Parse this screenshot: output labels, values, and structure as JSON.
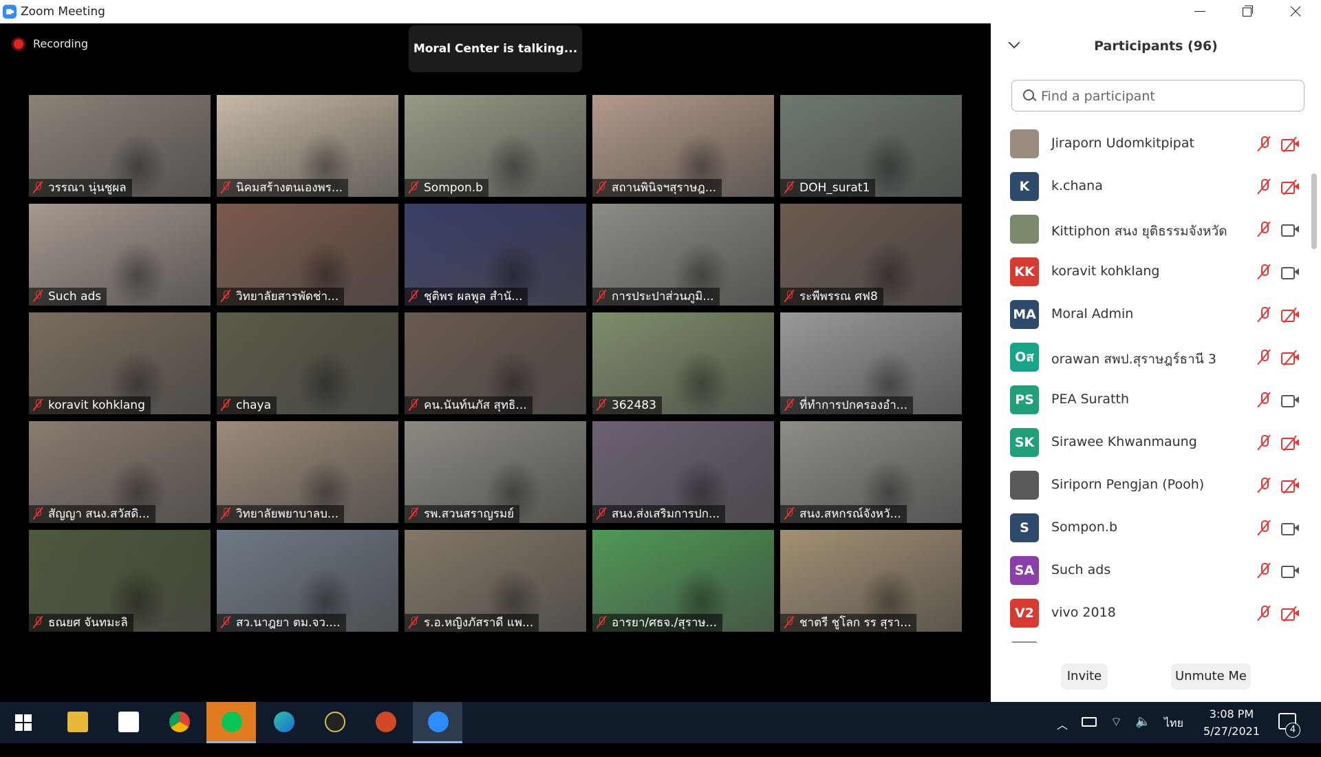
{
  "window": {
    "title": "Zoom Meeting"
  },
  "meeting": {
    "recording_label": "Recording",
    "talking_banner": "Moral Center is talking..."
  },
  "video_tiles": [
    {
      "name": "วรรณา นุ่นชูผล",
      "bg": "#8c8278"
    },
    {
      "name": "นิคมสร้างตนเองพร...",
      "bg": "#c7b9a6"
    },
    {
      "name": "Sompon.b",
      "bg": "#9a9a88"
    },
    {
      "name": "สถานพินิจฯสุราษฎ...",
      "bg": "#b59b8a"
    },
    {
      "name": "DOH_surat1",
      "bg": "#6e7a6e"
    },
    {
      "name": "Such ads",
      "bg": "#a79a90"
    },
    {
      "name": "วิทยาลัยสารพัดช่า...",
      "bg": "#7c5a4c"
    },
    {
      "name": "ชุติพร ผลพูล สำนั...",
      "bg": "#3a3f6a"
    },
    {
      "name": "การประปาส่วนภูมิ...",
      "bg": "#8d8d86"
    },
    {
      "name": "ระพีพรรณ ศฟ8",
      "bg": "#6b5a4f"
    },
    {
      "name": "koravit kohklang",
      "bg": "#7a6d5e"
    },
    {
      "name": "chaya",
      "bg": "#5d5a48"
    },
    {
      "name": "คน.นันท์นภัส สุทธิ...",
      "bg": "#6a5a50"
    },
    {
      "name": "362483",
      "bg": "#7f8e6a"
    },
    {
      "name": "ที่ทำการปกครองอำ...",
      "bg": "#9a9a9a"
    },
    {
      "name": "สัญญา สนง.สวัสดิ...",
      "bg": "#8a7c70"
    },
    {
      "name": "วิทยาลัยพยาบาลบ...",
      "bg": "#9c8b7a"
    },
    {
      "name": "รพ.สวนสราญรมย์",
      "bg": "#8d8a82"
    },
    {
      "name": "สนง.ส่งเสริมการปก...",
      "bg": "#6d6274"
    },
    {
      "name": "สนง.สหกรณ์จังหวั...",
      "bg": "#8e8d87"
    },
    {
      "name": "ธณยศ จันทมะลิ",
      "bg": "#4e5a3a"
    },
    {
      "name": "สว.นาฎยา ตม.จว....",
      "bg": "#6f7a86"
    },
    {
      "name": "ร.อ.หญิงภัสราดี แพ...",
      "bg": "#837868"
    },
    {
      "name": "อารยา/ศธจ./สุราษ...",
      "bg": "#4f9a55"
    },
    {
      "name": "ชาตรี ชูโลก รร สุรา...",
      "bg": "#a39173"
    }
  ],
  "participants_panel": {
    "title": "Participants (96)",
    "search_placeholder": "Find a participant",
    "participants": [
      {
        "name": "Jiraporn Udomkitpipat",
        "initials": "",
        "avatar_color": "#9a8c7c",
        "video_on": false
      },
      {
        "name": "k.chana",
        "initials": "K",
        "avatar_color": "#2e4a6b",
        "video_on": false
      },
      {
        "name": "Kittiphon สนง ยุติธรรมจังหวัด",
        "initials": "",
        "avatar_color": "#7a8a6a",
        "video_on": true
      },
      {
        "name": "koravit kohklang",
        "initials": "KK",
        "avatar_color": "#d93a2f",
        "video_on": true
      },
      {
        "name": "Moral Admin",
        "initials": "MA",
        "avatar_color": "#2e4a6b",
        "video_on": false
      },
      {
        "name": "orawan สพป.สุราษฎร์ธานี 3",
        "initials": "Oส",
        "avatar_color": "#17a58a",
        "video_on": false
      },
      {
        "name": "PEA Suratth",
        "initials": "PS",
        "avatar_color": "#1fa07a",
        "video_on": true
      },
      {
        "name": "Sirawee Khwanmaung",
        "initials": "SK",
        "avatar_color": "#1fa07a",
        "video_on": false
      },
      {
        "name": "Siriporn Pengjan (Pooh)",
        "initials": "",
        "avatar_color": "#5a5a5a",
        "video_on": false
      },
      {
        "name": "Sompon.b",
        "initials": "S",
        "avatar_color": "#2e4a6b",
        "video_on": true
      },
      {
        "name": "Such ads",
        "initials": "SA",
        "avatar_color": "#8b3fa8",
        "video_on": true
      },
      {
        "name": "vivo 2018",
        "initials": "V2",
        "avatar_color": "#d93a2f",
        "video_on": false
      }
    ],
    "invite_label": "Invite",
    "unmute_label": "Unmute Me"
  },
  "taskbar": {
    "apps": [
      "start-menu",
      "file-explorer",
      "microsoft-store",
      "chrome",
      "line",
      "edge",
      "camera-app",
      "powerpoint",
      "zoom"
    ],
    "language": "ไทย",
    "time": "3:08 PM",
    "date": "5/27/2021",
    "notification_count": "4"
  }
}
